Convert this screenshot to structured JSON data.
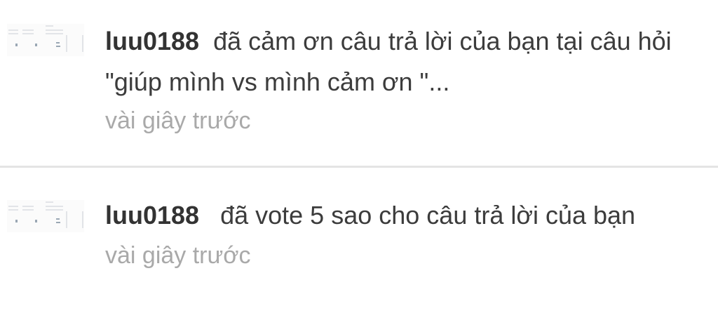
{
  "notifications": [
    {
      "user": "luu0188",
      "message": "đã cảm ơn câu trả lời của bạn tại câu hỏi \"giúp mình vs mình cảm ơn \"...",
      "time": "vài giây trước",
      "avatar_icon": "thumbnail-image-icon"
    },
    {
      "user": "luu0188",
      "message": "đã vote 5 sao cho câu trả lời của bạn",
      "time": "vài giây trước",
      "avatar_icon": "thumbnail-image-icon"
    }
  ],
  "colors": {
    "text": "#3c3c3c",
    "username": "#333333",
    "timestamp": "#a9a9a9",
    "divider": "#e4e4e4"
  }
}
